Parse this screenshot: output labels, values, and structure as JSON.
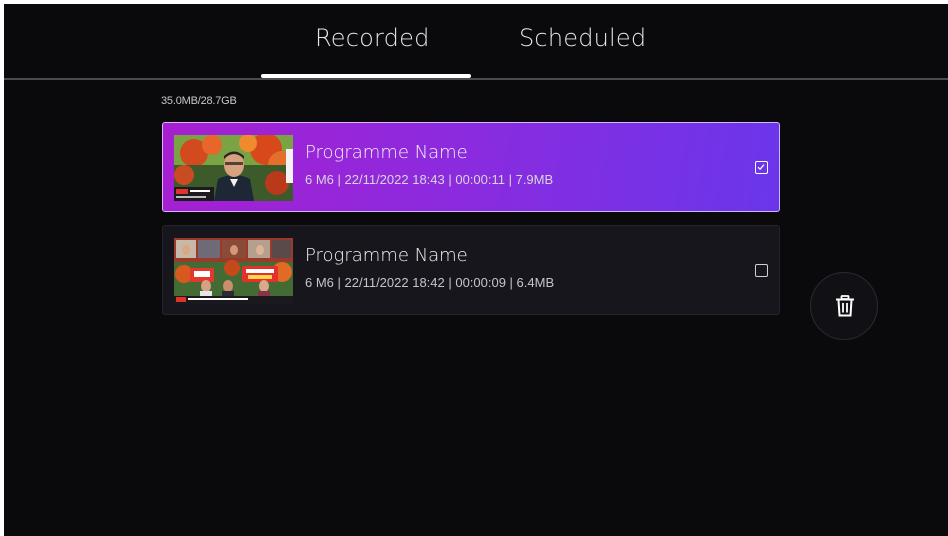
{
  "tabs": {
    "recorded_label": "Recorded",
    "scheduled_label": "Scheduled",
    "active": "Recorded"
  },
  "storage": {
    "usage_text": "35.0MB/28.7GB"
  },
  "recordings": [
    {
      "title": "Programme Name",
      "meta": "6 M6 | 22/11/2022 18:43 | 00:00:11 | 7.9MB",
      "checked": true,
      "thumbnail_icon": "thumbnail-news-presenter"
    },
    {
      "title": "Programme Name",
      "meta": "6 M6 | 22/11/2022 18:42 | 00:00:09 | 6.4MB",
      "checked": false,
      "thumbnail_icon": "thumbnail-panel-show"
    }
  ],
  "actions": {
    "delete_icon": "trash-icon"
  },
  "colors": {
    "background": "#0a0a0d",
    "selected_gradient_start": "#a71fd1",
    "selected_gradient_end": "#6a36ea",
    "item_background": "#16161c",
    "text_primary": "#f2f2f4"
  }
}
